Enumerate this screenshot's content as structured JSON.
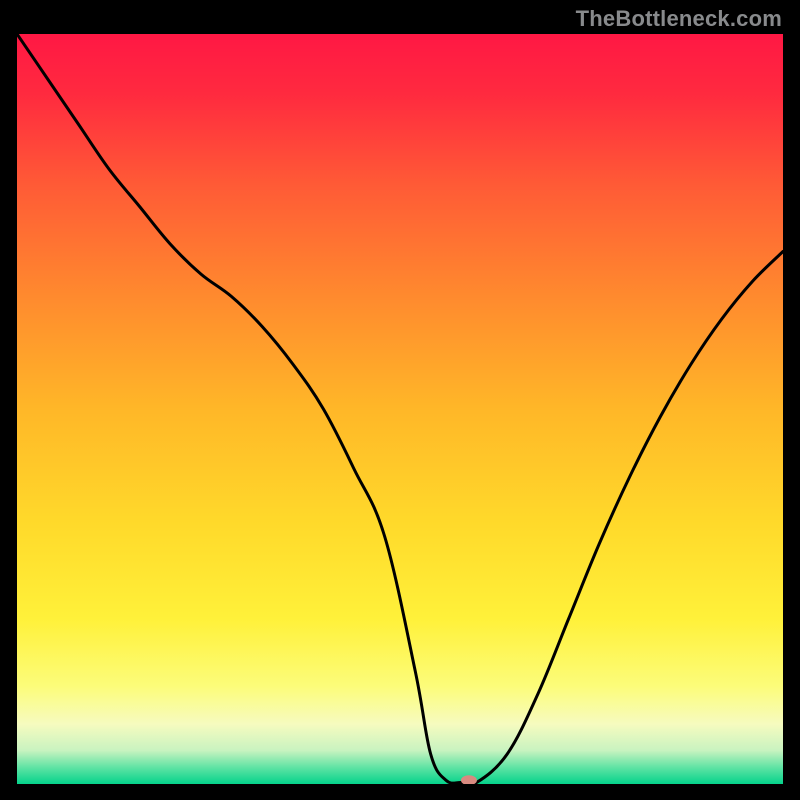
{
  "watermark": "TheBottleneck.com",
  "chart_data": {
    "type": "line",
    "title": "",
    "xlabel": "",
    "ylabel": "",
    "xlim": [
      0,
      100
    ],
    "ylim": [
      0,
      100
    ],
    "gradient_stops": [
      {
        "offset": 0.0,
        "color": "#ff1844"
      },
      {
        "offset": 0.08,
        "color": "#ff2a3f"
      },
      {
        "offset": 0.2,
        "color": "#ff5a36"
      },
      {
        "offset": 0.35,
        "color": "#ff8a2e"
      },
      {
        "offset": 0.5,
        "color": "#ffb728"
      },
      {
        "offset": 0.65,
        "color": "#ffd92a"
      },
      {
        "offset": 0.78,
        "color": "#fff13a"
      },
      {
        "offset": 0.87,
        "color": "#fcfc7a"
      },
      {
        "offset": 0.92,
        "color": "#f6fbbf"
      },
      {
        "offset": 0.955,
        "color": "#c9f3c0"
      },
      {
        "offset": 0.978,
        "color": "#5fe3a4"
      },
      {
        "offset": 1.0,
        "color": "#05d38b"
      }
    ],
    "series": [
      {
        "name": "curve",
        "color": "#000000",
        "x": [
          0,
          4,
          8,
          12,
          16,
          20,
          24,
          28,
          32,
          36,
          40,
          44,
          48,
          52,
          54,
          56,
          58,
          60,
          64,
          68,
          72,
          76,
          80,
          84,
          88,
          92,
          96,
          100
        ],
        "y": [
          100,
          94,
          88,
          82,
          77,
          72,
          68,
          65,
          61,
          56,
          50,
          42,
          33,
          15,
          4,
          0.5,
          0.2,
          0.2,
          4,
          12,
          22,
          32,
          41,
          49,
          56,
          62,
          67,
          71
        ]
      }
    ],
    "marker": {
      "name": "highlight-marker",
      "x": 59,
      "y": 0.5,
      "rx": 8,
      "ry": 5,
      "color": "#d88a80"
    }
  }
}
